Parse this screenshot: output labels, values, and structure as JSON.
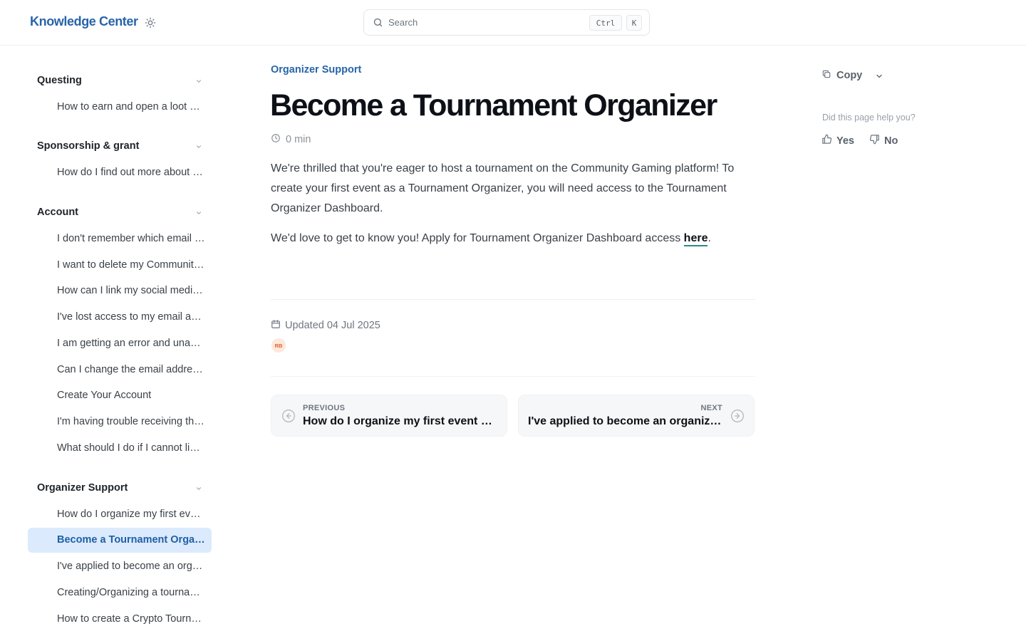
{
  "header": {
    "brand": "Knowledge Center",
    "search": {
      "placeholder": "Search",
      "shortcut_ctrl": "Ctrl",
      "shortcut_key": "K"
    }
  },
  "sidebar": {
    "groups": [
      {
        "title": "Questing",
        "items": [
          "How to earn and open a loot box"
        ]
      },
      {
        "title": "Sponsorship & grant",
        "items": [
          "How do I find out more about sponsorships and grants?"
        ]
      },
      {
        "title": "Account",
        "items": [
          "I don't remember which email I used to sign up",
          "I want to delete my Community Gaming account",
          "How can I link my social media accounts?",
          "I've lost access to my email account",
          "I am getting an error and unable to log in",
          "Can I change the email address on my account?",
          "Create Your Account",
          "I'm having trouble receiving the verification email",
          "What should I do if I cannot link my account?"
        ]
      },
      {
        "title": "Organizer Support",
        "items": [
          "How do I organize my first event?",
          "Become a Tournament Organizer",
          "I've applied to become an organizer",
          "Creating/Organizing a tournament",
          "How to create a Crypto Tournament"
        ]
      }
    ]
  },
  "main": {
    "breadcrumb": "Organizer Support",
    "title": "Become a Tournament Organizer",
    "read_time": "0 min",
    "paragraph_1": "We're thrilled that you're eager to host a tournament on the Community Gaming platform! To create your first event as a Tournament Organizer, you will need access to the Tournament Organizer Dashboard.",
    "paragraph_2_prefix": "We'd love to get to know you! Apply for Tournament Organizer Dashboard access ",
    "paragraph_2_link": "here",
    "paragraph_2_suffix": ".",
    "updated": "Updated 04 Jul 2025",
    "author_initials": "RB",
    "previous": {
      "label": "PREVIOUS",
      "title": "How do I organize my first event on Community Gaming?"
    },
    "next": {
      "label": "NEXT",
      "title": "I've applied to become an organizer, what's next?"
    }
  },
  "rail": {
    "copy_label": "Copy",
    "help_question": "Did this page help you?",
    "yes_label": "Yes",
    "no_label": "No"
  },
  "colors": {
    "accent": "#2764a8",
    "active_bg": "#dbeafc",
    "link_underline": "#2a8a88"
  }
}
